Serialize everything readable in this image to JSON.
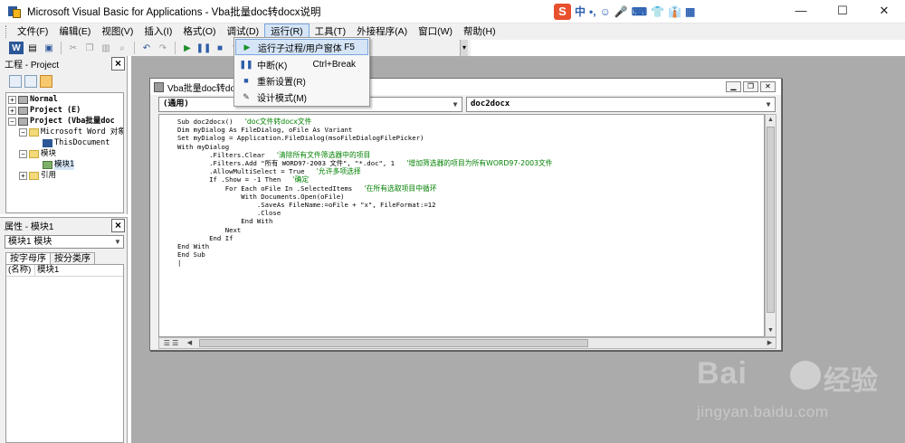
{
  "window": {
    "title": "Microsoft Visual Basic for Applications - Vba批量doc转docx说明",
    "controls": [
      "—",
      "☐",
      "✕"
    ]
  },
  "ime": {
    "logo": "S",
    "items": [
      "中",
      "•,",
      "☺",
      "🎤",
      "⌨",
      "👕",
      "👔",
      "▦"
    ]
  },
  "menubar": {
    "items": [
      "文件(F)",
      "编辑(E)",
      "视图(V)",
      "插入(I)",
      "格式(O)",
      "调试(D)",
      "运行(R)",
      "工具(T)",
      "外接程序(A)",
      "窗口(W)",
      "帮助(H)"
    ],
    "active_index": 6
  },
  "run_menu": {
    "items": [
      {
        "label": "运行子过程/用户窗体",
        "shortcut": "F5",
        "icon": "play-icon"
      },
      {
        "label": "中断(K)",
        "shortcut": "Ctrl+Break",
        "icon": "pause-icon"
      },
      {
        "label": "重新设置(R)",
        "shortcut": "",
        "icon": "stop-icon"
      },
      {
        "label": "设计模式(M)",
        "shortcut": "",
        "icon": "design-mode-icon"
      }
    ]
  },
  "project_panel": {
    "title": "工程 - Project",
    "tree": [
      {
        "label": "Normal",
        "bold": true
      },
      {
        "label": "Project (E)",
        "bold": true
      },
      {
        "label": "Project (Vba批量doc",
        "bold": true
      },
      {
        "label": "Microsoft Word 对象"
      },
      {
        "label": "ThisDocument"
      },
      {
        "label": "模块"
      },
      {
        "label": "模块1"
      },
      {
        "label": "引用"
      }
    ]
  },
  "props_panel": {
    "title": "属性 - 模块1",
    "object_combo": "模块1 模块",
    "tabs": [
      "按字母序",
      "按分类序"
    ],
    "rows": [
      {
        "name": "(名称)",
        "value": "模块1"
      }
    ]
  },
  "code_window": {
    "title": "Vba批量doc转doc",
    "object_combo": "(通用)",
    "proc_combo": "doc2docx",
    "lines": [
      {
        "code": "Sub doc2docx()",
        "comment": "'doc文件转docx文件"
      },
      {
        "code": "Dim myDialog As FileDialog, oFile As Variant",
        "comment": ""
      },
      {
        "code": "Set myDialog = Application.FileDialog(msoFileDialogFilePicker)",
        "comment": ""
      },
      {
        "code": "With myDialog",
        "comment": ""
      },
      {
        "code": "        .Filters.Clear",
        "comment": "'清除所有文件筛选器中的项目"
      },
      {
        "code": "        .Filters.Add \"所有 WORD97-2003 文件\", \"*.doc\", 1",
        "comment": "'增加筛选器的项目为所有WORD97-2003文件"
      },
      {
        "code": "        .AllowMultiSelect = True",
        "comment": "'允许多项选择"
      },
      {
        "code": "        If .Show = -1 Then",
        "comment": "'确定"
      },
      {
        "code": "            For Each oFile In .SelectedItems",
        "comment": "'在所有选取项目中循环"
      },
      {
        "code": "                With Documents.Open(oFile)",
        "comment": ""
      },
      {
        "code": "                    .SaveAs FileName:=oFile + \"x\", FileFormat:=12",
        "comment": ""
      },
      {
        "code": "                    .Close",
        "comment": ""
      },
      {
        "code": "                End With",
        "comment": ""
      },
      {
        "code": "            Next",
        "comment": ""
      },
      {
        "code": "        End If",
        "comment": ""
      },
      {
        "code": "End With",
        "comment": ""
      },
      {
        "code": "End Sub",
        "comment": ""
      },
      {
        "code": "|",
        "comment": ""
      }
    ]
  },
  "watermark": {
    "logo": "Bai",
    "brand_cn": "经验",
    "url": "jingyan.baidu.com"
  }
}
